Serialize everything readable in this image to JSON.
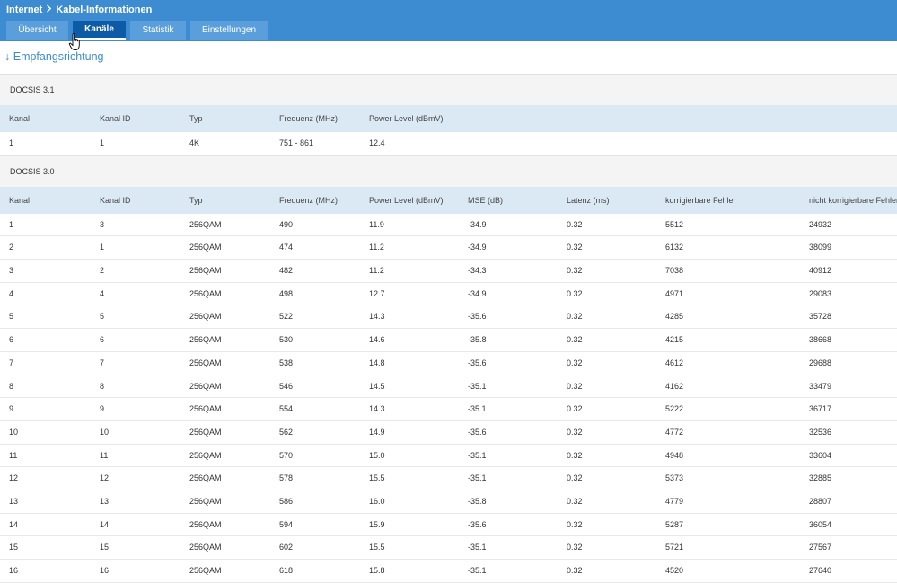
{
  "breadcrumb": {
    "root": "Internet",
    "current": "Kabel-Informationen"
  },
  "tabs": [
    {
      "label": "Übersicht",
      "active": false
    },
    {
      "label": "Kanäle",
      "active": true
    },
    {
      "label": "Statistik",
      "active": false
    },
    {
      "label": "Einstellungen",
      "active": false
    }
  ],
  "section": {
    "arrow": "↓",
    "title": "Empfangsrichtung"
  },
  "docsis31": {
    "group_label": "DOCSIS 3.1",
    "columns": [
      "Kanal",
      "Kanal ID",
      "Typ",
      "Frequenz (MHz)",
      "Power Level (dBmV)"
    ],
    "rows": [
      [
        "1",
        "1",
        "4K",
        "751 - 861",
        "12.4"
      ]
    ]
  },
  "docsis30": {
    "group_label": "DOCSIS 3.0",
    "columns": [
      "Kanal",
      "Kanal ID",
      "Typ",
      "Frequenz (MHz)",
      "Power Level (dBmV)",
      "MSE (dB)",
      "Latenz (ms)",
      "korrigierbare Fehler",
      "nicht korrigierbare Fehler"
    ],
    "rows": [
      [
        "1",
        "3",
        "256QAM",
        "490",
        "11.9",
        "-34.9",
        "0.32",
        "5512",
        "24932"
      ],
      [
        "2",
        "1",
        "256QAM",
        "474",
        "11.2",
        "-34.9",
        "0.32",
        "6132",
        "38099"
      ],
      [
        "3",
        "2",
        "256QAM",
        "482",
        "11.2",
        "-34.3",
        "0.32",
        "7038",
        "40912"
      ],
      [
        "4",
        "4",
        "256QAM",
        "498",
        "12.7",
        "-34.9",
        "0.32",
        "4971",
        "29083"
      ],
      [
        "5",
        "5",
        "256QAM",
        "522",
        "14.3",
        "-35.6",
        "0.32",
        "4285",
        "35728"
      ],
      [
        "6",
        "6",
        "256QAM",
        "530",
        "14.6",
        "-35.8",
        "0.32",
        "4215",
        "38668"
      ],
      [
        "7",
        "7",
        "256QAM",
        "538",
        "14.8",
        "-35.6",
        "0.32",
        "4612",
        "29688"
      ],
      [
        "8",
        "8",
        "256QAM",
        "546",
        "14.5",
        "-35.1",
        "0.32",
        "4162",
        "33479"
      ],
      [
        "9",
        "9",
        "256QAM",
        "554",
        "14.3",
        "-35.1",
        "0.32",
        "5222",
        "36717"
      ],
      [
        "10",
        "10",
        "256QAM",
        "562",
        "14.9",
        "-35.6",
        "0.32",
        "4772",
        "32536"
      ],
      [
        "11",
        "11",
        "256QAM",
        "570",
        "15.0",
        "-35.1",
        "0.32",
        "4948",
        "33604"
      ],
      [
        "12",
        "12",
        "256QAM",
        "578",
        "15.5",
        "-35.1",
        "0.32",
        "5373",
        "32885"
      ],
      [
        "13",
        "13",
        "256QAM",
        "586",
        "16.0",
        "-35.8",
        "0.32",
        "4779",
        "28807"
      ],
      [
        "14",
        "14",
        "256QAM",
        "594",
        "15.9",
        "-35.6",
        "0.32",
        "5287",
        "36054"
      ],
      [
        "15",
        "15",
        "256QAM",
        "602",
        "15.5",
        "-35.1",
        "0.32",
        "5721",
        "27567"
      ],
      [
        "16",
        "16",
        "256QAM",
        "618",
        "15.8",
        "-35.1",
        "0.32",
        "4520",
        "27640"
      ]
    ]
  }
}
